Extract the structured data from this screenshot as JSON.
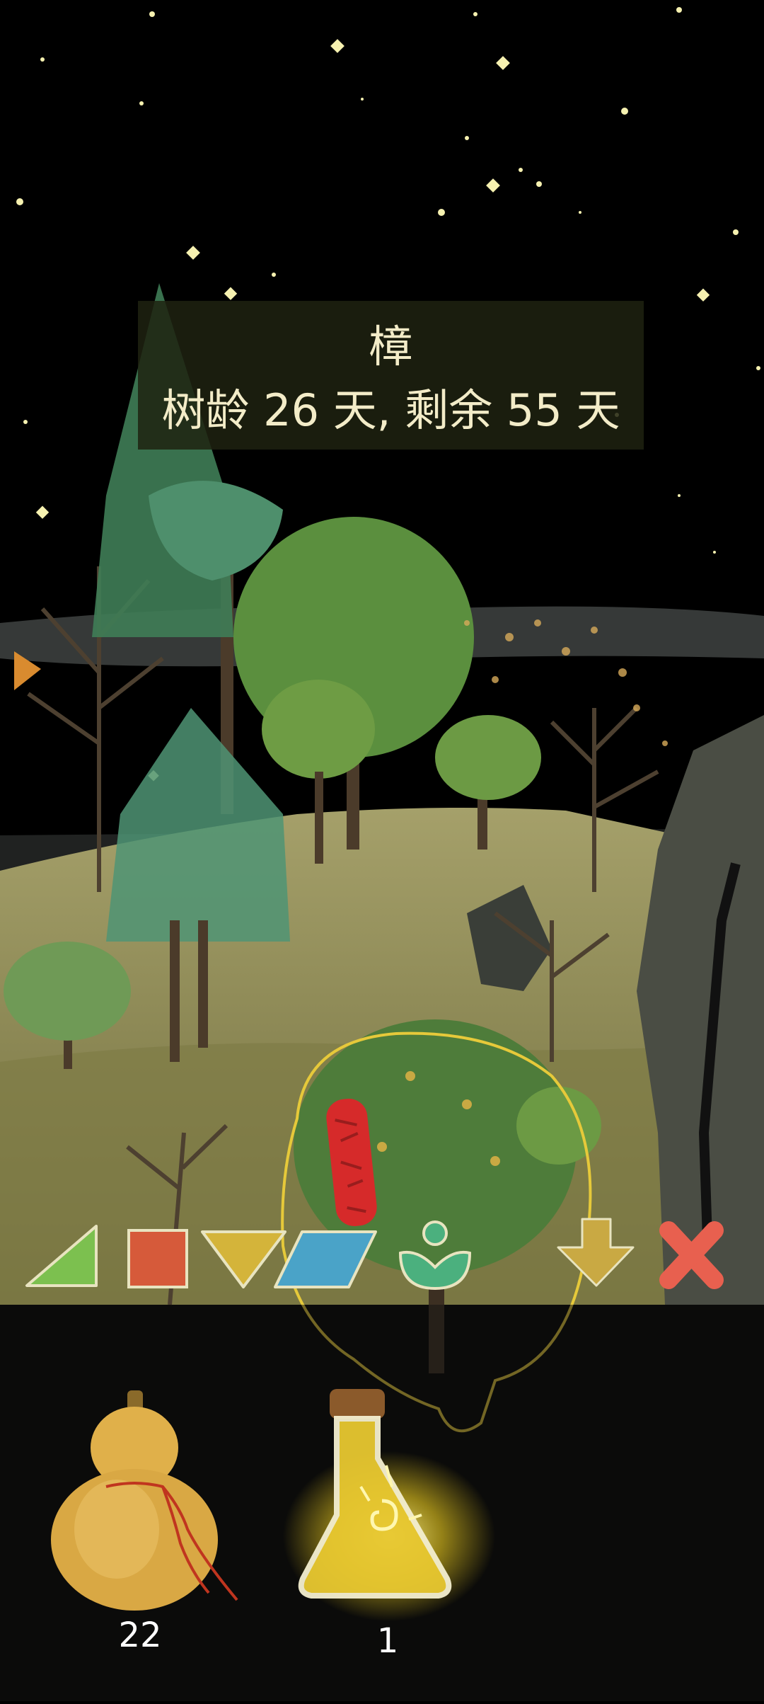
{
  "tree_info": {
    "name": "樟",
    "age_text": "树龄 26 天, 剩余 55 天"
  },
  "toolbar": {
    "tools": [
      {
        "icon": "green-triangle-icon",
        "color": "#7cc04f"
      },
      {
        "icon": "red-square-icon",
        "color": "#d65a3a"
      },
      {
        "icon": "yellow-inverted-triangle-icon",
        "color": "#d4b43a"
      },
      {
        "icon": "blue-parallelogram-icon",
        "color": "#4aa3c8"
      },
      {
        "icon": "sprout-icon",
        "color": "#4bb07e"
      },
      {
        "icon": "down-arrow-icon",
        "color": "#c9a943"
      },
      {
        "icon": "close-icon",
        "color": "#e8604f"
      }
    ]
  },
  "inventory": {
    "gourd_count": "22",
    "potion_count": "1"
  },
  "colors": {
    "selection_outline": "#e6c93a",
    "seal_red": "#d62a2a",
    "grass": "#8c8a4a"
  }
}
